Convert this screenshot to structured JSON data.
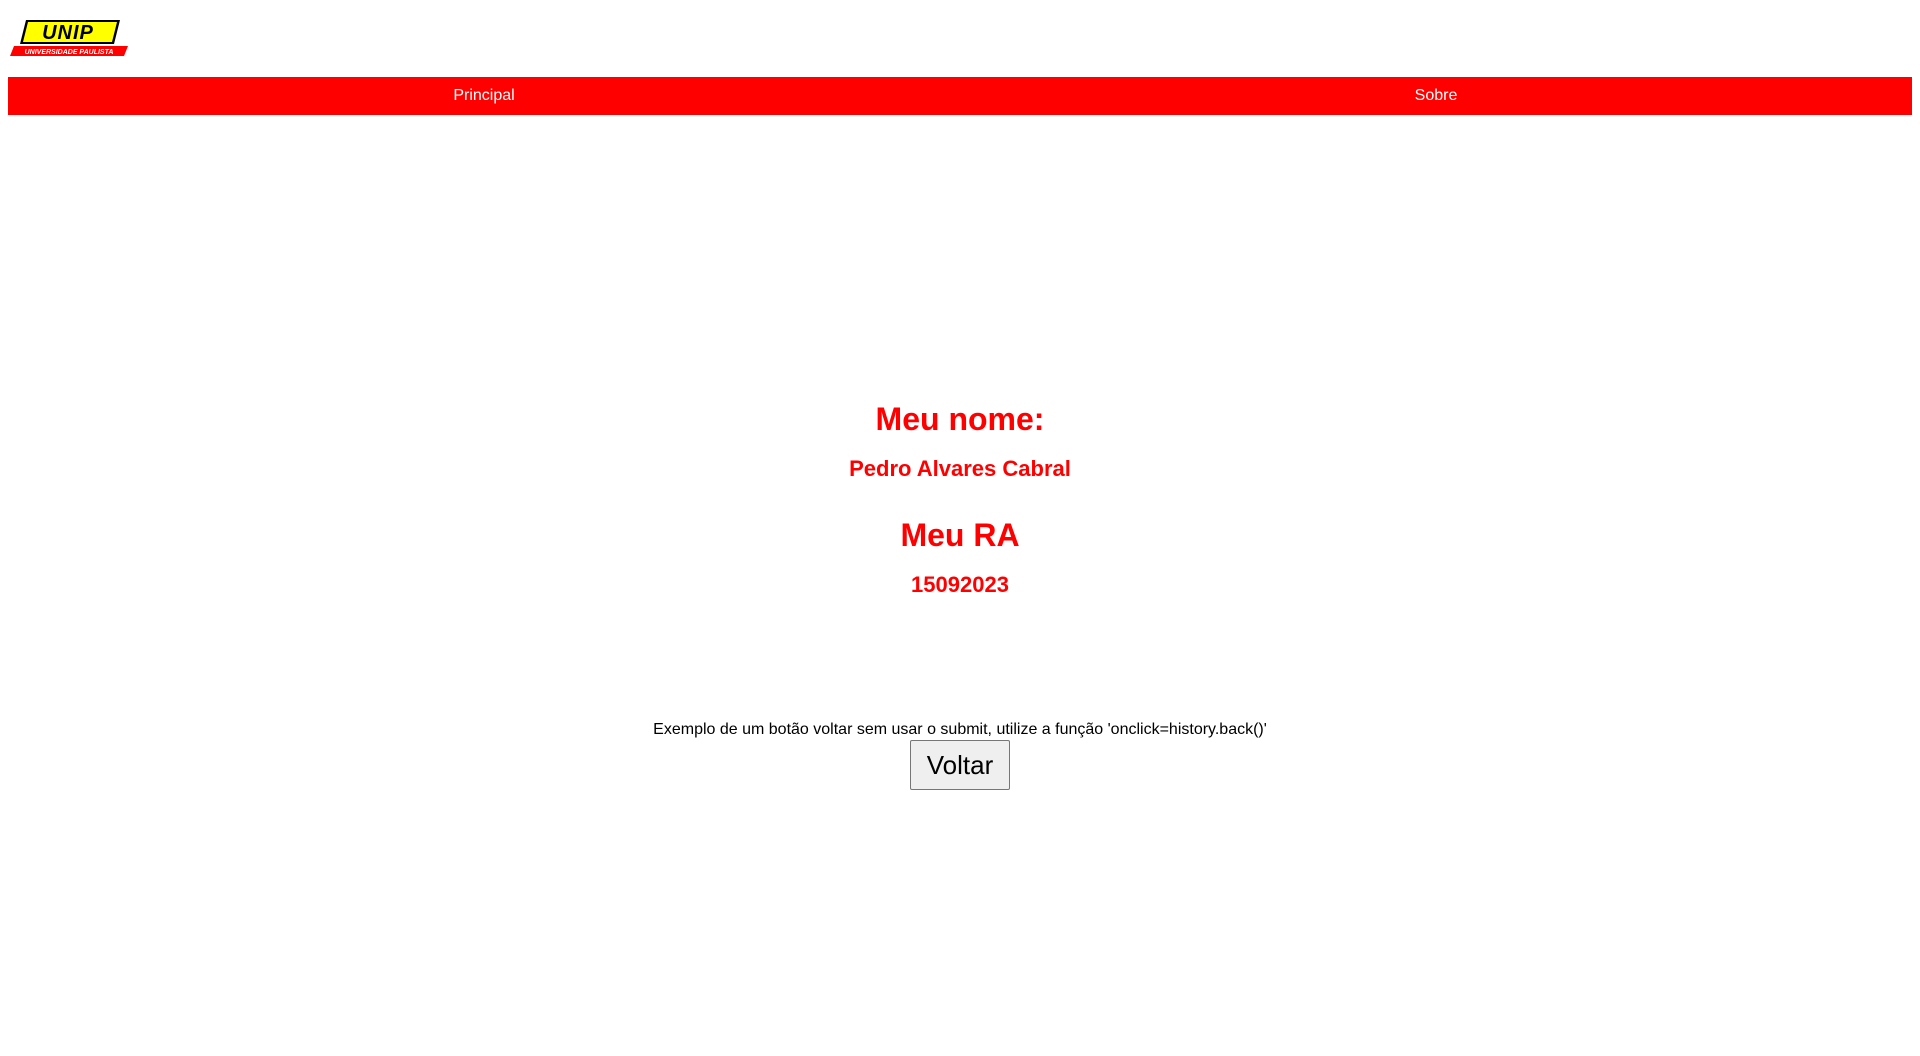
{
  "logo": {
    "text": "UNIP",
    "subtext": "UNIVERSIDADE PAULISTA",
    "colors": {
      "main": "#ffff00",
      "band": "#ff0000"
    }
  },
  "nav": {
    "items": [
      {
        "label": "Principal"
      },
      {
        "label": "Sobre"
      }
    ],
    "color": "#ff0000"
  },
  "content": {
    "name_heading": "Meu nome:",
    "name_value": "Pedro Alvares Cabral",
    "ra_heading": "Meu RA",
    "ra_value": "15092023",
    "color": "#ff0000"
  },
  "example": {
    "text": "Exemplo de um botão voltar sem usar o submit, utilize a função 'onclick=history.back()'",
    "button_label": "Voltar"
  }
}
